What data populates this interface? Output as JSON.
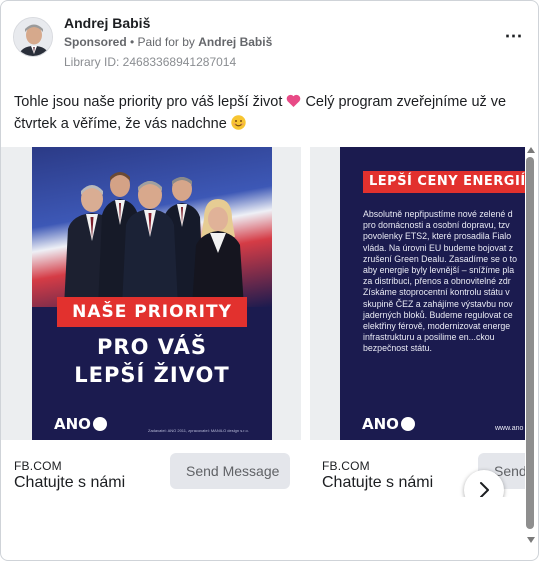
{
  "post": {
    "page_name": "Andrej Babiš",
    "sponsored_label": "Sponsored",
    "separator": " • ",
    "paid_for_prefix": "Paid for by ",
    "payer": "Andrej Babiš",
    "library_id": "Library ID: 24683368941287014",
    "more_icon": "⋯",
    "text_line": "Tohle jsou naše priority pro váš lepší život",
    "text_after_heart": " Celý program zveřejníme už ve čtvrtek a věříme, že vás nadchne ",
    "heart_icon": "heart-emoji",
    "smile_icon": "smiling-face-emoji"
  },
  "carousel": {
    "cards": [
      {
        "domain": "FB.COM",
        "title": "Chatujte s námi",
        "cta": "Send Message",
        "creative": {
          "banner": "NAŠE PRIORITY",
          "headline_1": "PRO VÁŠ",
          "headline_2": "LEPŠÍ ŽIVOT",
          "logo": "ANO",
          "footer": "Zadavatel: ANO 2011, zpracovatel: MANILO design s.r.o."
        }
      },
      {
        "domain": "FB.COM",
        "title": "Chatujte s námi",
        "cta": "Send Message",
        "creative": {
          "banner": "LEPŠÍ CENY ENERGIÍ",
          "body": "Absolutně nepřipustíme nové zelené d\npro domácnosti a osobní dopravu, tzv\npovolenky ETS2, které prosadila Fialo\nvláda. Na úrovni EU budeme bojovat z\nzrušení Green Dealu. Zasadíme se o to\naby energie byly levnější – snížíme pla\nza distribuci, přenos a obnovitelné zdr\nZískáme stoprocentní kontrolu státu v\nskupině ČEZ a zahájíme výstavbu nov\njaderných bloků. Budeme regulovat ce\nelektřiny férově, modernizovat energe\ninfrastrukturu a posilime en...ckou\nbezpečnost státu.",
          "logo": "ANO",
          "url": "www.ano"
        }
      }
    ],
    "next_icon": "chevron-right-icon"
  },
  "scrollbar": {
    "up_icon": "arrow-up-icon",
    "down_icon": "arrow-down-icon"
  }
}
